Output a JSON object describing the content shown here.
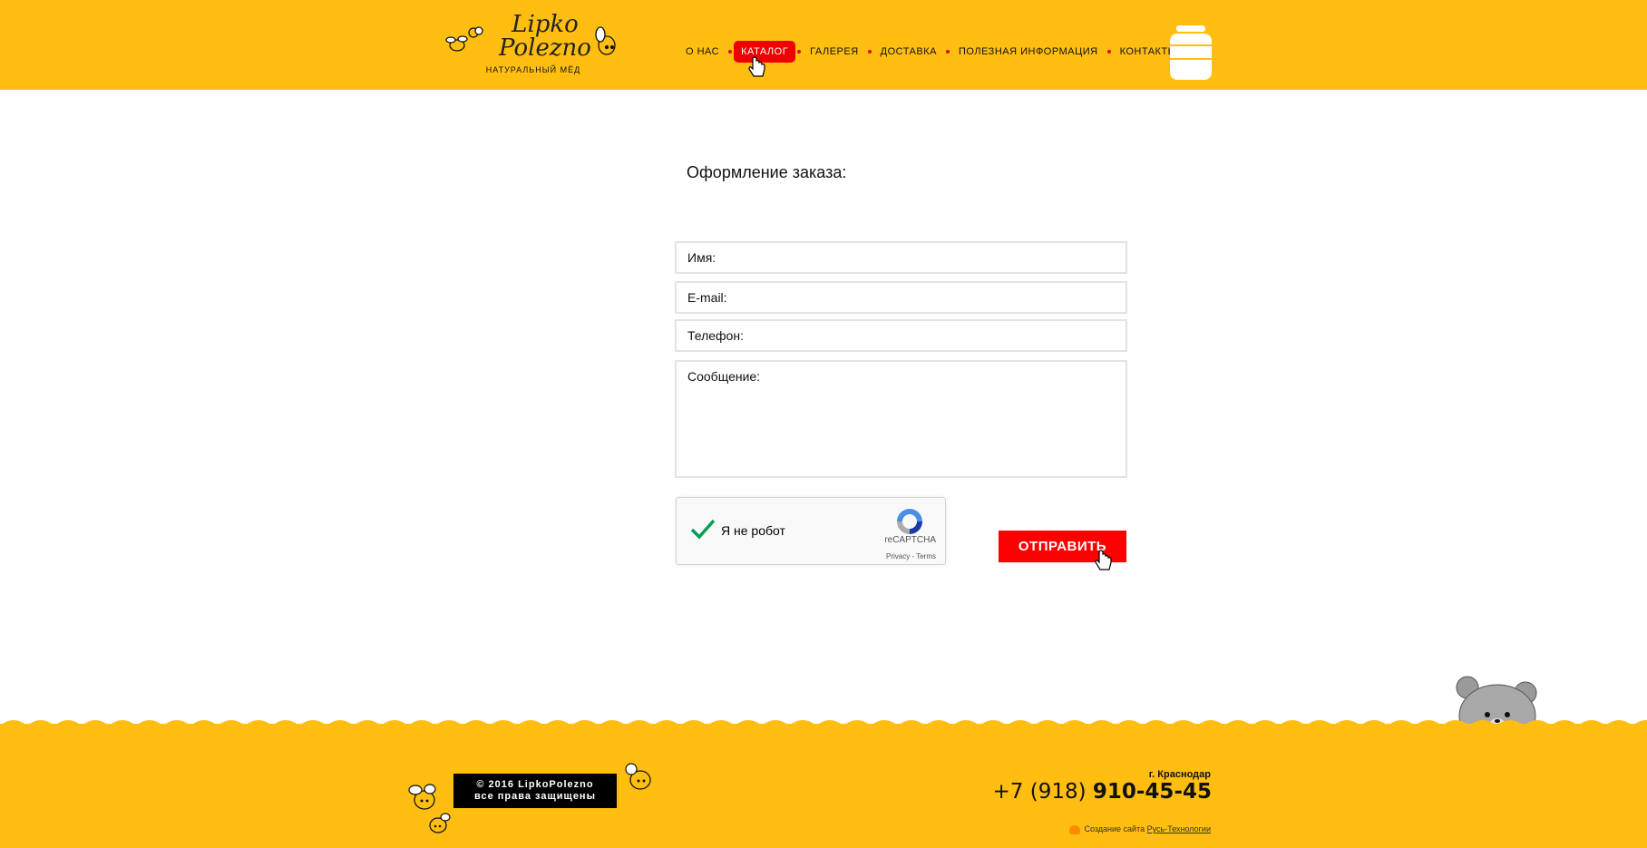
{
  "header": {
    "logo": {
      "line1": "Lipko",
      "line2": "Polezno",
      "subtitle": "НАТУРАЛЬНЫЙ МЁД"
    },
    "nav": [
      {
        "label": "О НАС",
        "active": false
      },
      {
        "label": "КАТАЛОГ",
        "active": true
      },
      {
        "label": "ГАЛЕРЕЯ",
        "active": false
      },
      {
        "label": "ДОСТАВКА",
        "active": false
      },
      {
        "label": "ПОЛЕЗНАЯ ИНФОРМАЦИЯ",
        "active": false
      },
      {
        "label": "КОНТАКТЫ",
        "active": false
      }
    ],
    "cart_icon": "honey-jar-icon"
  },
  "main": {
    "title": "Оформление заказа:",
    "form": {
      "name_placeholder": "Имя:",
      "name_value": "",
      "email_placeholder": "E-mail:",
      "email_value": "",
      "phone_placeholder": "Телефон:",
      "phone_value": "",
      "message_placeholder": "Сообщение:",
      "message_value": "",
      "captcha": {
        "label": "Я не робот",
        "checked": true,
        "brand": "reCAPTCHA",
        "links": "Privacy - Terms"
      },
      "submit_label": "ОТПРАВИТЬ"
    }
  },
  "footer": {
    "copyright_line1": "© 2016 LipkoPolezno",
    "copyright_line2": "все права защищены",
    "city": "г. Краснодар",
    "phone_prefix": "+7 (918) ",
    "phone_number": "910-45-45",
    "credits_text": "Создание сайта",
    "credits_link": "Русь-Технологии"
  },
  "colors": {
    "brand_yellow": "#ffbe10",
    "accent_red": "#ff0000",
    "nav_dot": "#e8001c"
  }
}
